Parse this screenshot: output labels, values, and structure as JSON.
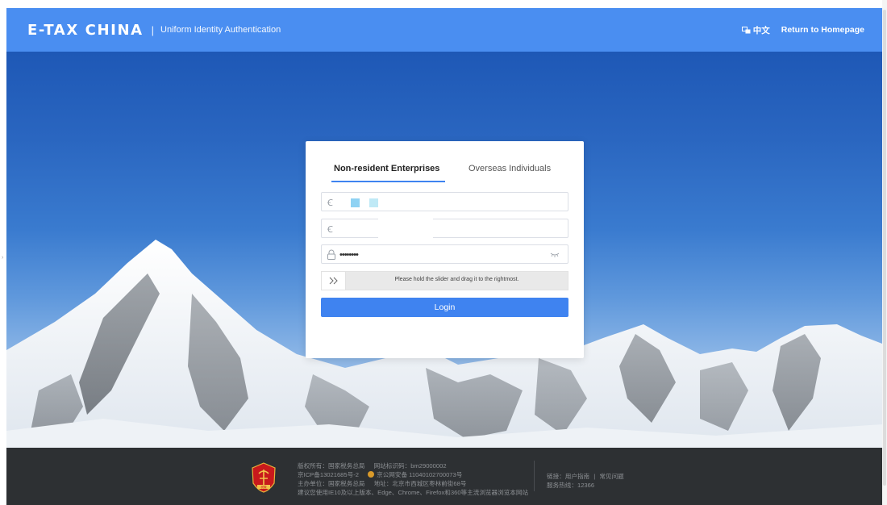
{
  "header": {
    "brand": "E-TAX CHINA",
    "separator": "|",
    "subtitle": "Uniform Identity Authentication",
    "lang_label": "中文",
    "home_link": "Return to Homepage",
    "bg_color": "#4a8ef1"
  },
  "login": {
    "tabs": [
      {
        "label": "Non-resident Enterprises",
        "active": true
      },
      {
        "label": "Overseas Individuals",
        "active": false
      }
    ],
    "fields": [
      {
        "icon": "id-card-icon",
        "value": ""
      },
      {
        "icon": "user-icon",
        "value": ""
      },
      {
        "icon": "lock-icon",
        "value": "••••••••"
      }
    ],
    "slider_text": "Please hold the slider and drag it to the rightmost.",
    "login_button": "Login",
    "accent_color": "#3f83f0"
  },
  "footer": {
    "copyright_label": "版权所有：国家税务总局",
    "site_id": "网站标识码：bm29000002",
    "icp": "京ICP备13021685号-2",
    "police": "京公网安备 11040102700073号",
    "host": "主办单位：国家税务总局",
    "address": "地址：北京市西城区枣林前街68号",
    "browser_tip": "建议您使用IE10及以上版本、Edge、Chrome、Firefox和360等主流浏览器浏览本网站",
    "links_label": "链接：",
    "link_user_guide": "用户指南",
    "link_sep": "|",
    "link_faq": "常见问题",
    "hotline": "服务热线：12366",
    "emblem_text": "税徽"
  }
}
